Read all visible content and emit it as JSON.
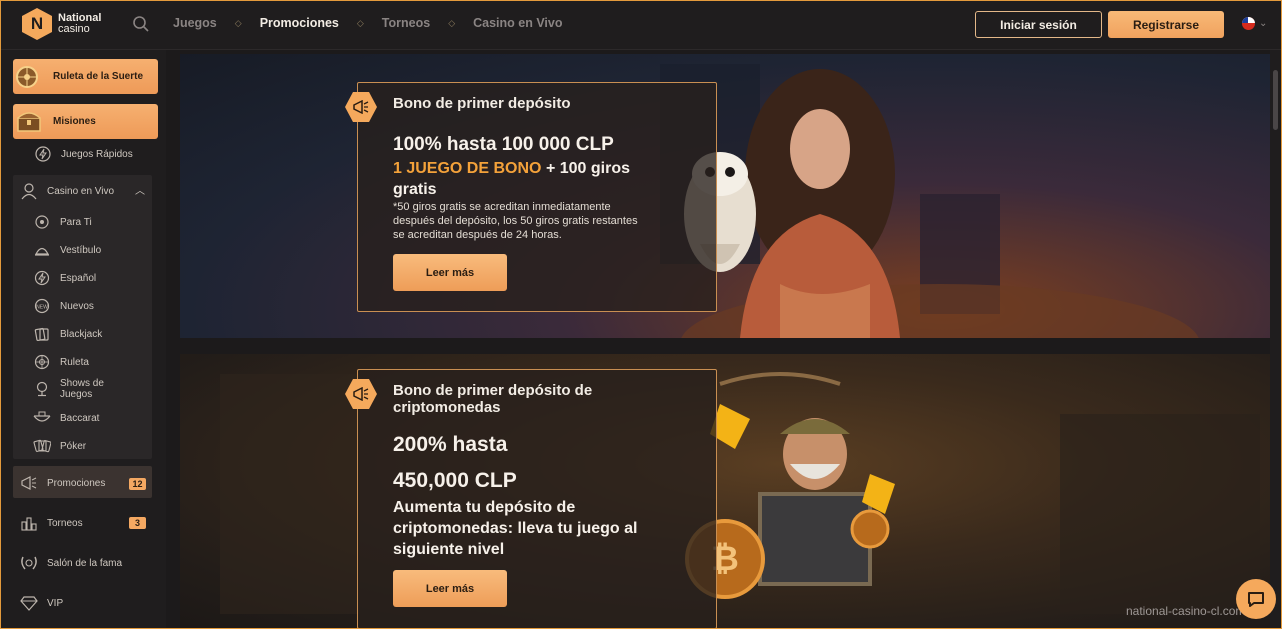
{
  "brand": {
    "name": "National",
    "sub": "casino",
    "letter": "N"
  },
  "nav": {
    "items": [
      {
        "label": "Juegos",
        "active": false
      },
      {
        "label": "Promociones",
        "active": true
      },
      {
        "label": "Torneos",
        "active": false
      },
      {
        "label": "Casino en Vivo",
        "active": false
      }
    ]
  },
  "auth": {
    "login": "Iniciar sesión",
    "register": "Registrarse"
  },
  "sidebar": {
    "wheel": "Ruleta de la Suerte",
    "missions": "Misiones",
    "quick_games": "Juegos Rápidos",
    "live_casino": "Casino en Vivo",
    "live_items": [
      "Para Ti",
      "Vestíbulo",
      "Español",
      "Nuevos",
      "Blackjack",
      "Ruleta",
      "Shows de",
      "Juegos",
      "Baccarat",
      "Póker"
    ],
    "promotions": "Promociones",
    "promotions_count": "12",
    "tournaments": "Torneos",
    "tournaments_count": "3",
    "hall_of_fame": "Salón de la fama",
    "vip": "VIP"
  },
  "promos": [
    {
      "title": "Bono de primer depósito",
      "headline": "100% hasta 100 000 CLP",
      "highlight": "1 JUEGO DE BONO",
      "extra": "+ 100 giros",
      "extra2": "gratis",
      "note": "*50 giros gratis se acreditan inmediatamente después del depósito, los 50 giros gratis restantes se acreditan después de 24 horas.",
      "button": "Leer más"
    },
    {
      "title_line1": "Bono de primer depósito de",
      "title_line2": "criptomonedas",
      "headline1": "200% hasta",
      "headline2": "450,000 CLP",
      "body": "Aumenta tu depósito de criptomonedas: lleva tu juego al siguiente nivel",
      "button": "Leer más"
    }
  ],
  "watermark": "national-casino-cl.com",
  "colors": {
    "accent": "#f5a95c",
    "frame": "#e39a3c"
  }
}
